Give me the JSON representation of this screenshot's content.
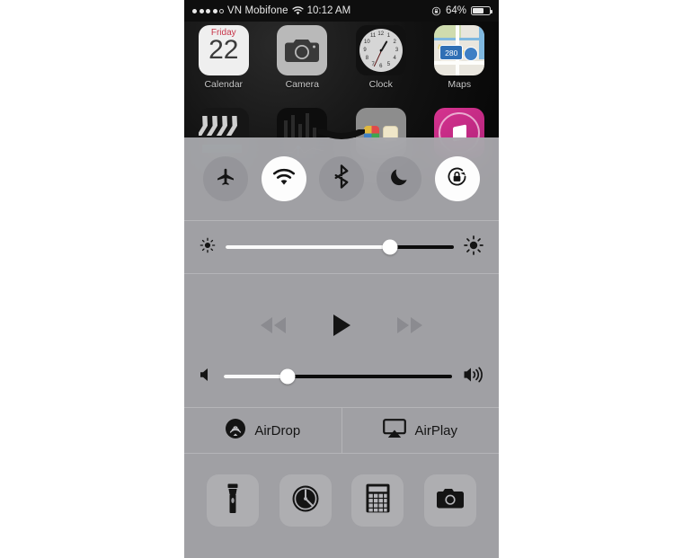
{
  "status_bar": {
    "signal_dots": [
      true,
      true,
      true,
      true,
      false
    ],
    "carrier": "VN Mobifone",
    "wifi_icon": "wifi-icon",
    "time": "10:12 AM",
    "rotation_lock_icon": "rotation-lock-icon",
    "battery_percent": "64%",
    "battery_level": 64
  },
  "home_screen": {
    "row1": [
      {
        "label": "Calendar",
        "icon": "calendar-icon",
        "weekday": "Friday",
        "day": "22"
      },
      {
        "label": "Camera",
        "icon": "camera-icon"
      },
      {
        "label": "Clock",
        "icon": "clock-icon",
        "numerals": [
          "12",
          "1",
          "2",
          "3",
          "4",
          "5",
          "6",
          "7",
          "8",
          "9",
          "10",
          "11"
        ]
      },
      {
        "label": "Maps",
        "icon": "maps-icon",
        "route_shield": "280"
      }
    ],
    "row2": [
      {
        "label": "",
        "icon": "imovie-icon"
      },
      {
        "label": "",
        "icon": "health-icon"
      },
      {
        "label": "",
        "icon": "extras-folder-icon"
      },
      {
        "label": "",
        "icon": "itunes-store-icon"
      }
    ]
  },
  "control_center": {
    "grabber": "grabber-handle",
    "toggles": [
      {
        "name": "airplane-mode",
        "icon": "airplane-icon",
        "active": false
      },
      {
        "name": "wifi",
        "icon": "wifi-icon",
        "active": true
      },
      {
        "name": "bluetooth",
        "icon": "bluetooth-icon",
        "active": false
      },
      {
        "name": "do-not-disturb",
        "icon": "moon-icon",
        "active": false
      },
      {
        "name": "rotation-lock",
        "icon": "rotation-lock-icon",
        "active": true
      }
    ],
    "brightness": {
      "low_icon": "brightness-low-icon",
      "high_icon": "brightness-high-icon",
      "value": 72
    },
    "media": {
      "previous_icon": "rewind-icon",
      "play_icon": "play-icon",
      "next_icon": "fast-forward-icon",
      "previous_enabled": false,
      "next_enabled": false,
      "playing": false
    },
    "volume": {
      "mute_icon": "volume-low-icon",
      "max_icon": "volume-high-icon",
      "value": 28
    },
    "sharing": [
      {
        "label": "AirDrop",
        "icon": "airdrop-icon"
      },
      {
        "label": "AirPlay",
        "icon": "airplay-icon"
      }
    ],
    "shortcuts": [
      {
        "name": "flashlight",
        "icon": "flashlight-icon"
      },
      {
        "name": "timer",
        "icon": "timer-icon"
      },
      {
        "name": "calculator",
        "icon": "calculator-icon"
      },
      {
        "name": "camera",
        "icon": "camera-icon"
      }
    ]
  },
  "colors": {
    "panel": "#aaaaae",
    "toggle_off": "#8c8c91",
    "toggle_on": "#fdfdfd",
    "slider_track": "#0c0c0c",
    "slider_fill": "#fafafa",
    "icon_dark": "#141414",
    "icon_dim": "#8b8b90"
  }
}
